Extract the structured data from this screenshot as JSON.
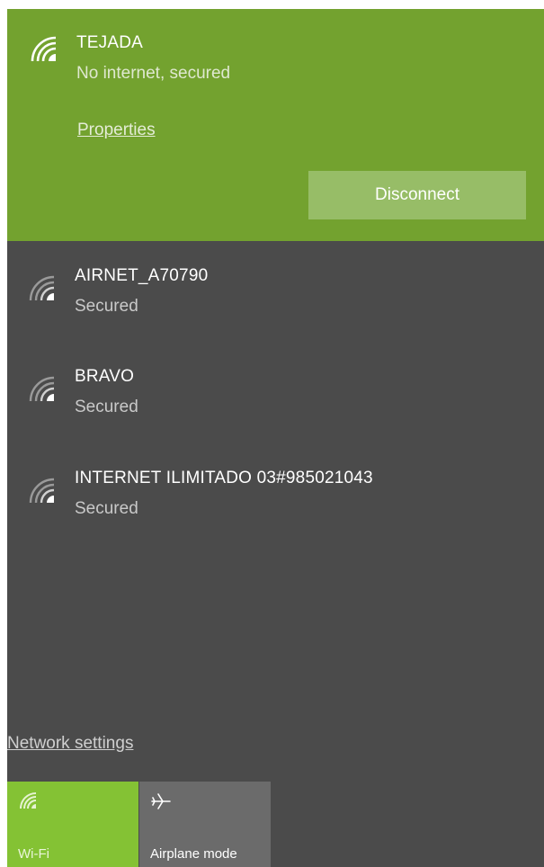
{
  "connected_network": {
    "name": "TEJADA",
    "status": "No internet, secured",
    "properties_label": "Properties",
    "disconnect_label": "Disconnect",
    "icon": "wifi-icon"
  },
  "networks": [
    {
      "name": "AIRNET_A70790",
      "status": "Secured",
      "icon": "wifi-icon"
    },
    {
      "name": "BRAVO",
      "status": "Secured",
      "icon": "wifi-icon"
    },
    {
      "name": "INTERNET ILIMITADO 03#985021043",
      "status": "Secured",
      "icon": "wifi-icon"
    }
  ],
  "network_settings_label": "Network settings",
  "quick_actions": [
    {
      "label": "Wi-Fi",
      "icon": "wifi-icon",
      "active": true,
      "color": "#84c234"
    },
    {
      "label": "Airplane mode",
      "icon": "airplane-icon",
      "active": false,
      "color": "#6b6b6b"
    }
  ],
  "colors": {
    "accent": "#73a22f",
    "panel_background": "#4b4b4b",
    "disconnect_button": "#97bd67"
  }
}
